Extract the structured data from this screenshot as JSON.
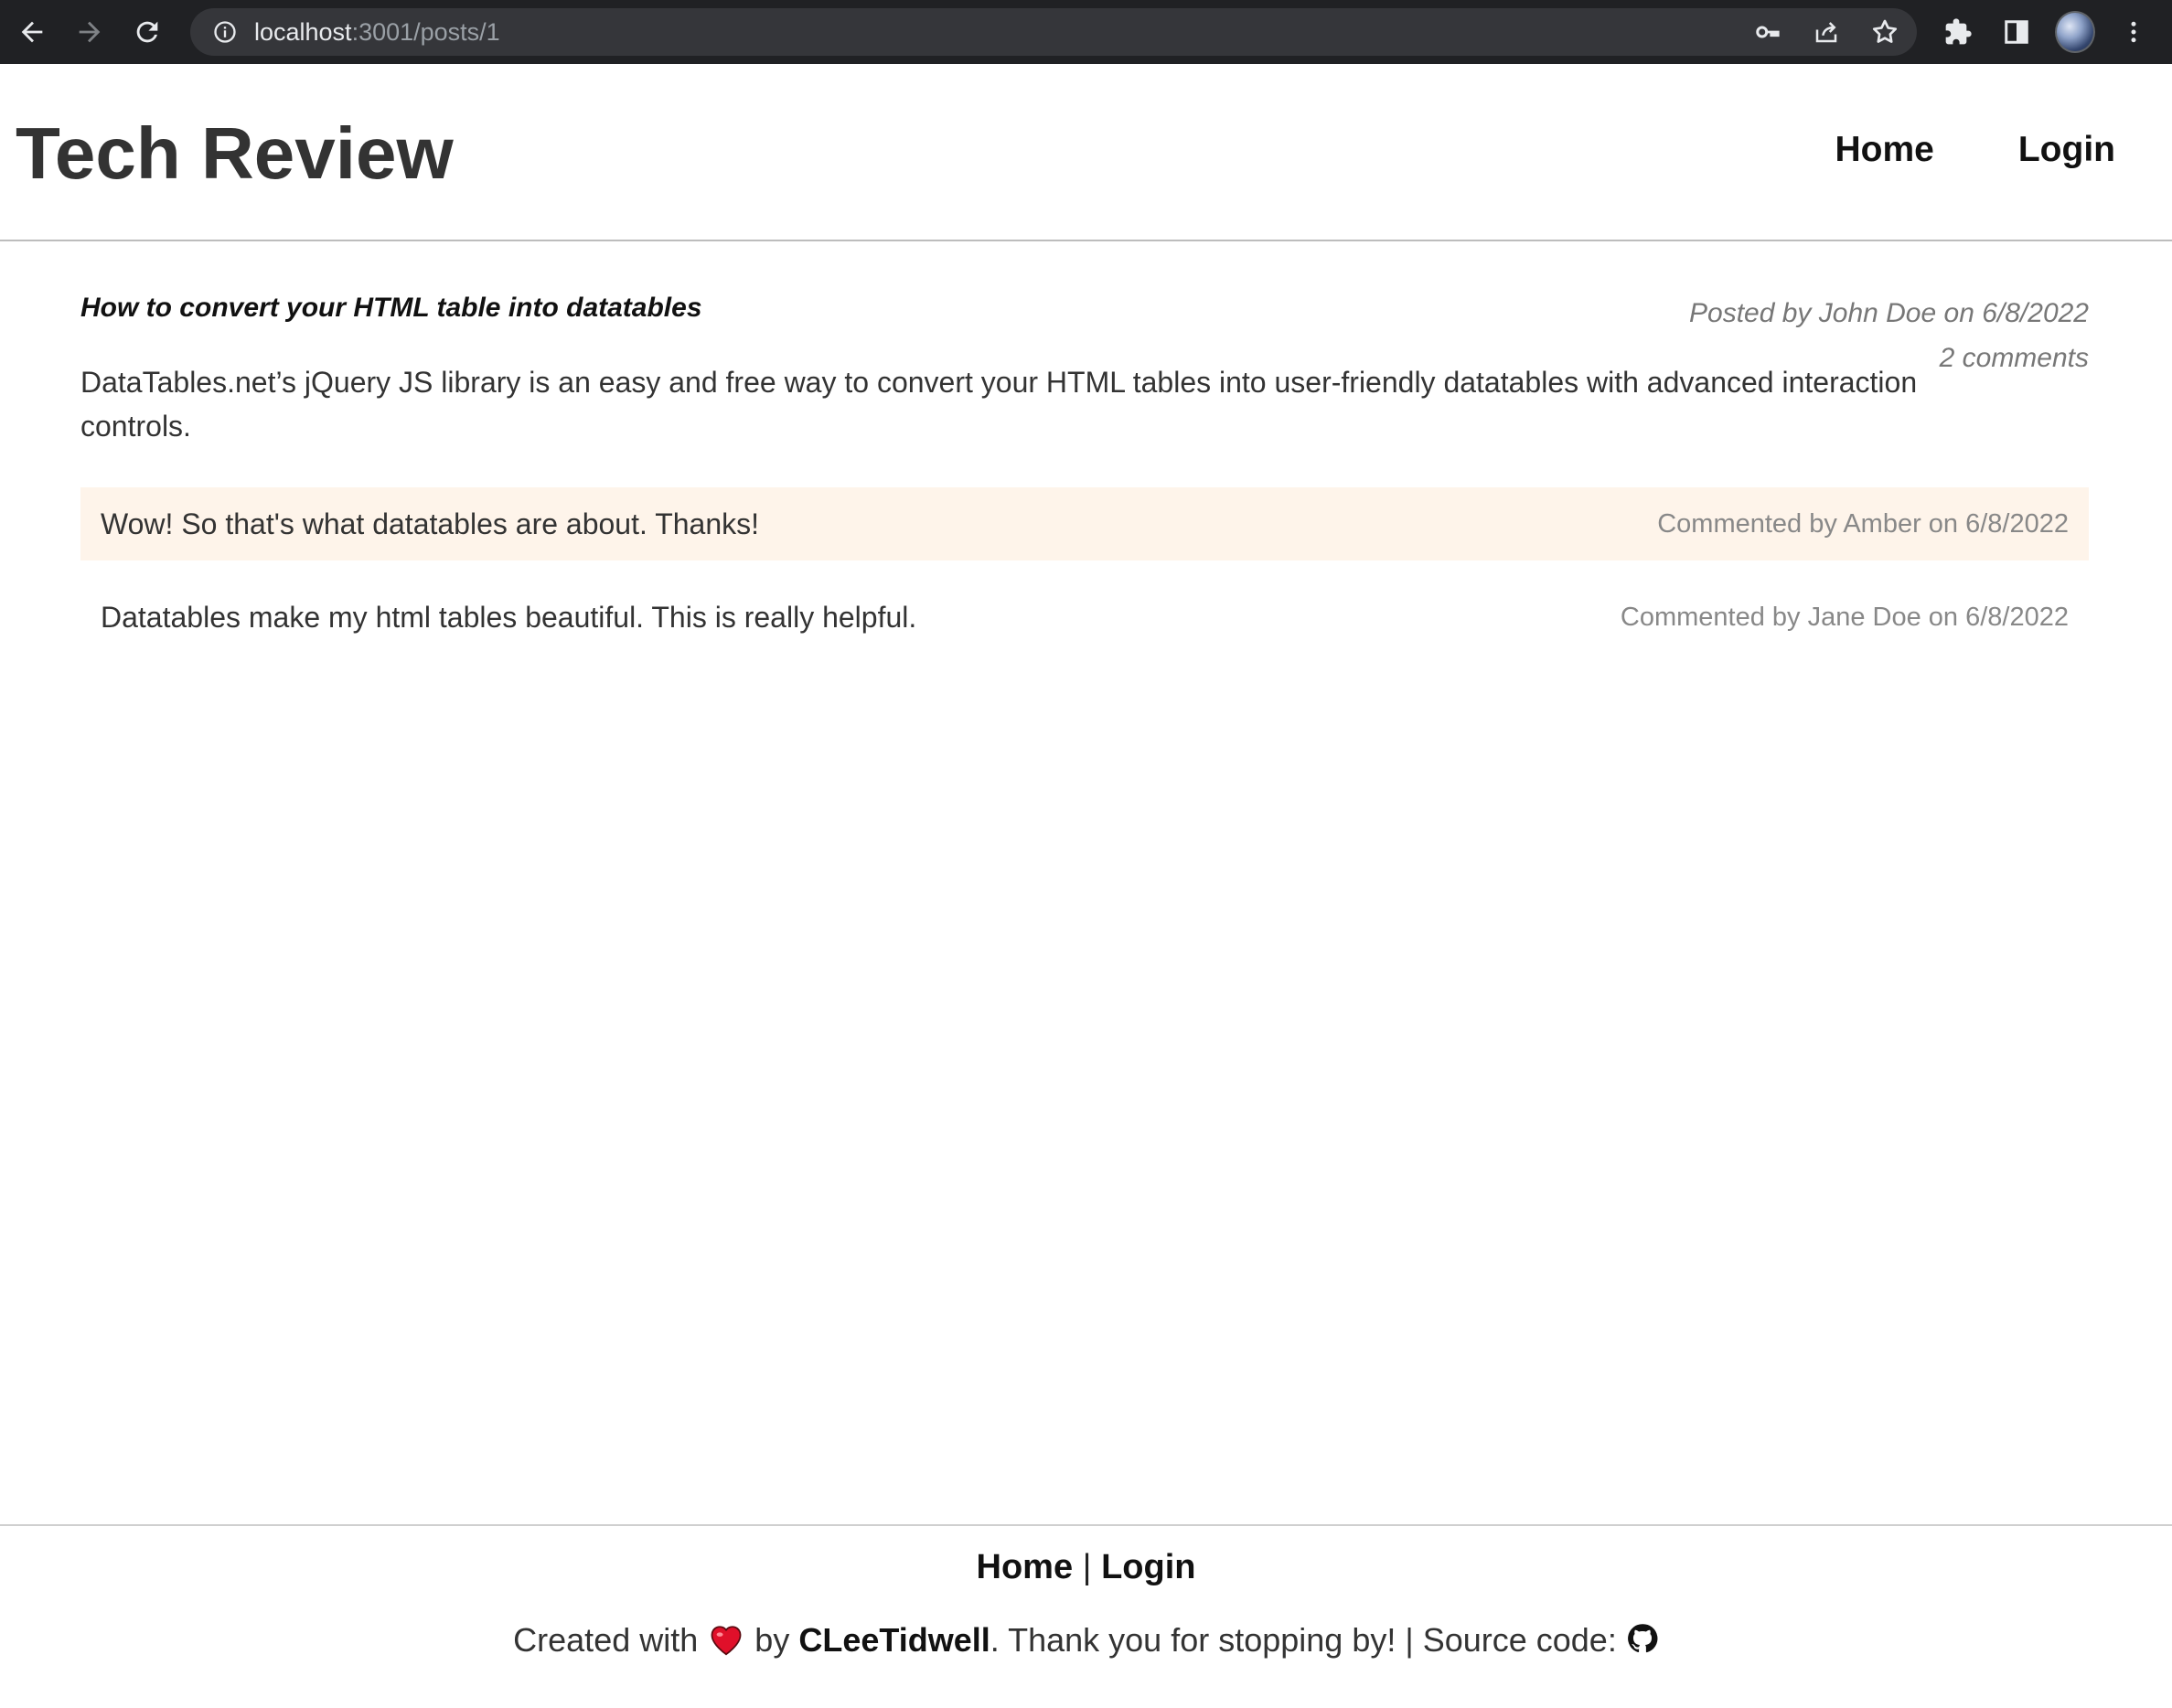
{
  "browser": {
    "url_host": "localhost",
    "url_path": ":3001/posts/1"
  },
  "site": {
    "title": "Tech Review",
    "nav": {
      "home": "Home",
      "login": "Login"
    }
  },
  "post": {
    "title": "How to convert your HTML table into datatables",
    "posted_by": "Posted by John Doe on 6/8/2022",
    "comment_count": "2 comments",
    "body": "DataTables.net’s jQuery JS library is an easy and free way to convert your HTML tables into user-friendly datatables with advanced interaction controls."
  },
  "comments": [
    {
      "text": "Wow! So that's what datatables are about. Thanks!",
      "by": "Commented by Amber on 6/8/2022"
    },
    {
      "text": "Datatables make my html tables beautiful. This is really helpful.",
      "by": "Commented by Jane Doe on 6/8/2022"
    }
  ],
  "footer": {
    "home": "Home",
    "separator": "|",
    "login": "Login",
    "created_with": "Created with",
    "by": "by",
    "author": "CLeeTidwell",
    "thanks": ". Thank you for stopping by! | Source code:"
  },
  "colors": {
    "comment_highlight": "#fef4ea",
    "chrome_bg": "#202124",
    "heart": "#e0102a"
  }
}
